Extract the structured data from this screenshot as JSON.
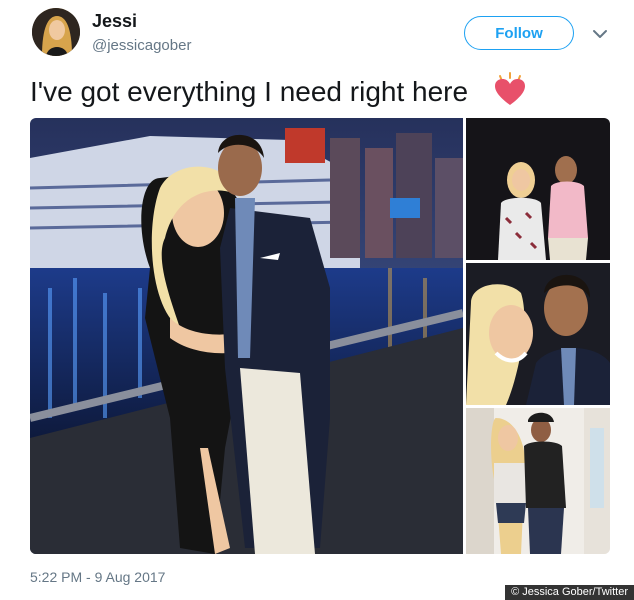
{
  "user": {
    "name": "Jessi",
    "handle": "@jessicagober"
  },
  "follow_button": {
    "label": "Follow"
  },
  "tweet": {
    "text": "I've got everything I need right here",
    "emoji_icon": "growing-heart-icon",
    "timestamp": "5:22 PM - 9 Aug 2017"
  },
  "credit": "Jessica Gober/Twitter",
  "colors": {
    "accent": "#1da1f2",
    "secondary_text": "#657786",
    "primary_text": "#14171a",
    "heart": "#e8506a"
  }
}
